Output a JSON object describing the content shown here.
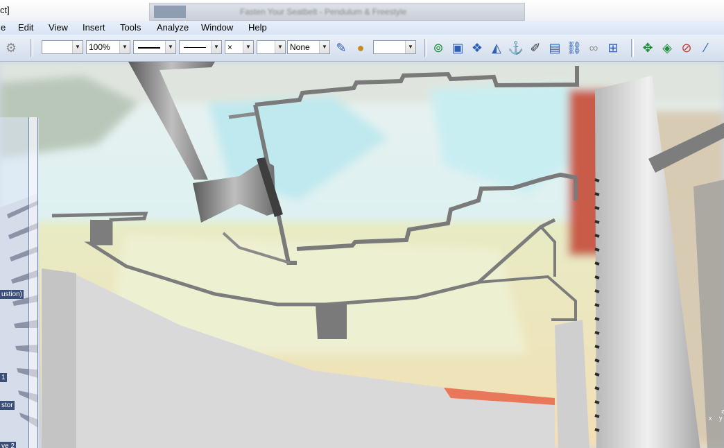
{
  "window": {
    "title_visible": "ct]",
    "ghost_tab_text": "Fasten Your Seatbelt - Pendulum & Freestyle"
  },
  "menu": [
    {
      "id": "file",
      "label": "e"
    },
    {
      "id": "edit",
      "label": "Edit"
    },
    {
      "id": "view",
      "label": "View"
    },
    {
      "id": "insert",
      "label": "Insert"
    },
    {
      "id": "tools",
      "label": "Tools"
    },
    {
      "id": "analyze",
      "label": "Analyze"
    },
    {
      "id": "window",
      "label": "Window"
    },
    {
      "id": "help",
      "label": "Help"
    }
  ],
  "toolbar": {
    "color_combo": "",
    "zoom_combo": "100%",
    "linetype_combo": "",
    "lineweight_combo": "",
    "point_combo": "×",
    "layer_combo": "",
    "material_combo": "None",
    "extra_combo": ""
  },
  "tree": {
    "labels": [
      "ustion)",
      "1",
      "stor",
      "ve 2"
    ]
  },
  "compass": {
    "z": "z",
    "x": "x",
    "y": "y"
  },
  "colors": {
    "menubar": "#dbe5f4",
    "toolbar": "#d9e2ef",
    "icon_green": "#1f8f3a",
    "icon_blue": "#2b5fb8",
    "sky": "#cfeef0",
    "ground": "#efe2b8",
    "part_grey": "#9a9a9a"
  },
  "icons": [
    "open-icon",
    "explode-icon",
    "box-icon",
    "boxes-icon",
    "draft-icon",
    "anchor-icon",
    "pencil-icon",
    "sheet-icon",
    "chain-icon",
    "link-icon",
    "grid-icon",
    "move-icon",
    "rotate-icon",
    "unpin-icon",
    "wand-icon"
  ]
}
